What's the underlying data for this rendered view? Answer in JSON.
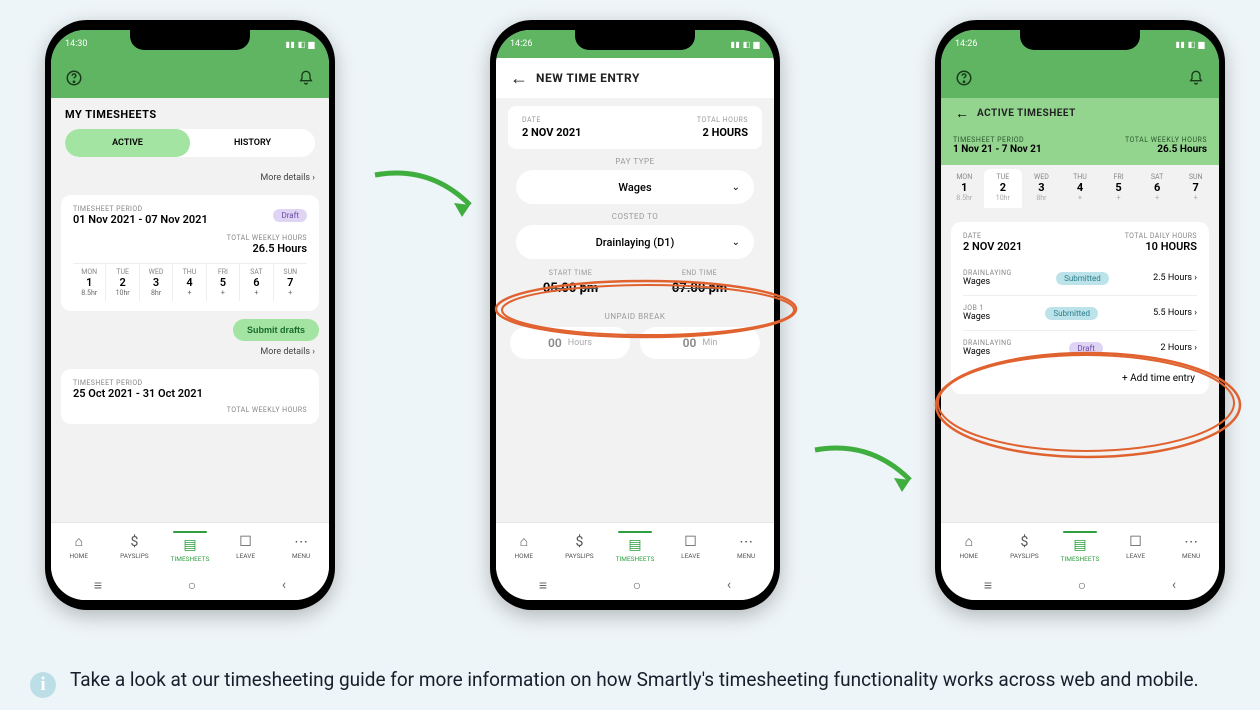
{
  "footnote": "Take a look at our timesheeting guide for more information on how Smartly's timesheeting functionality works across web and mobile.",
  "nav": {
    "home": "HOME",
    "payslips": "PAYSLIPS",
    "timesheets": "TIMESHEETS",
    "leave": "LEAVE",
    "menu": "MENU"
  },
  "phone1": {
    "time": "14:30",
    "title": "MY TIMESHEETS",
    "segActive": "ACTIVE",
    "segHistory": "HISTORY",
    "moreDetails": "More details",
    "period1Label": "TIMESHEET PERIOD",
    "period1Value": "01 Nov 2021 - 07 Nov 2021",
    "draftBadge": "Draft",
    "totalWeeklyLabel": "TOTAL WEEKLY HOURS",
    "totalWeeklyValue": "26.5 Hours",
    "days": [
      {
        "label": "MON",
        "num": "1",
        "val": "8.5hr"
      },
      {
        "label": "TUE",
        "num": "2",
        "val": "10hr"
      },
      {
        "label": "WED",
        "num": "3",
        "val": "8hr"
      },
      {
        "label": "THU",
        "num": "4",
        "val": "+"
      },
      {
        "label": "FRI",
        "num": "5",
        "val": "+"
      },
      {
        "label": "SAT",
        "num": "6",
        "val": "+"
      },
      {
        "label": "SUN",
        "num": "7",
        "val": "+"
      }
    ],
    "submit": "Submit drafts",
    "period2Label": "TIMESHEET PERIOD",
    "period2Value": "25 Oct 2021 - 31 Oct 2021",
    "totalWeeklyLabel2": "TOTAL WEEKLY HOURS"
  },
  "phone2": {
    "time": "14:26",
    "title": "NEW TIME ENTRY",
    "dateLabel": "DATE",
    "dateValue": "2 NOV 2021",
    "totalHoursLabel": "TOTAL HOURS",
    "totalHoursValue": "2 HOURS",
    "payTypeLabel": "PAY TYPE",
    "payTypeValue": "Wages",
    "costedLabel": "COSTED TO",
    "costedValue": "Drainlaying (D1)",
    "startLabel": "START TIME",
    "endLabel": "END TIME",
    "startValue": "05:00 pm",
    "endValue": "07:00 pm",
    "breakLabel": "UNPAID BREAK",
    "breakHoursNum": "00",
    "breakHoursUnit": "Hours",
    "breakMinNum": "00",
    "breakMinUnit": "Min"
  },
  "phone3": {
    "time": "14:26",
    "title": "ACTIVE TIMESHEET",
    "periodLabel": "TIMESHEET PERIOD",
    "periodValue": "1 Nov 21 - 7 Nov 21",
    "weeklyLabel": "TOTAL WEEKLY HOURS",
    "weeklyValue": "26.5 Hours",
    "days": [
      {
        "label": "MON",
        "num": "1",
        "val": "8.5hr"
      },
      {
        "label": "TUE",
        "num": "2",
        "val": "10hr"
      },
      {
        "label": "WED",
        "num": "3",
        "val": "8hr"
      },
      {
        "label": "THU",
        "num": "4",
        "val": "+"
      },
      {
        "label": "FRI",
        "num": "5",
        "val": "+"
      },
      {
        "label": "SAT",
        "num": "6",
        "val": "+"
      },
      {
        "label": "SUN",
        "num": "7",
        "val": "+"
      }
    ],
    "dateLabel": "DATE",
    "dateValue": "2 NOV 2021",
    "dailyLabel": "TOTAL DAILY HOURS",
    "dailyValue": "10 HOURS",
    "entries": [
      {
        "job": "DRAINLAYING",
        "type": "Wages",
        "status": "Submitted",
        "statusClass": "submitted",
        "hours": "2.5 Hours"
      },
      {
        "job": "JOB 1",
        "type": "Wages",
        "status": "Submitted",
        "statusClass": "submitted",
        "hours": "5.5 Hours"
      },
      {
        "job": "DRAINLAYING",
        "type": "Wages",
        "status": "Draft",
        "statusClass": "draft",
        "hours": "2 Hours"
      }
    ],
    "addEntry": "+ Add time entry"
  }
}
